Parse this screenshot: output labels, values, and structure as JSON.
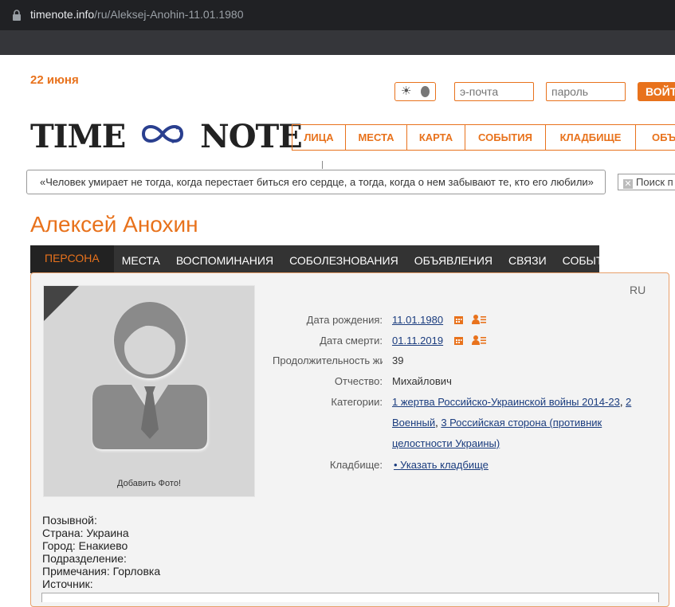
{
  "browser": {
    "url_domain": "timenote.info",
    "url_path": "/ru/Aleksej-Anohin-11.01.1980"
  },
  "header": {
    "date": "22 июня",
    "email_placeholder": "э-почта",
    "password_placeholder": "пароль",
    "login_label": "ВОЙТ",
    "logo_left": "TIME",
    "logo_right": "NOTE"
  },
  "mainnav": [
    {
      "label": "ЛИЦА"
    },
    {
      "label": "МЕСТА"
    },
    {
      "label": "КАРТА"
    },
    {
      "label": "СОБЫТИЯ"
    },
    {
      "label": "КЛАДБИЩЕ"
    },
    {
      "label": "ОБЪ"
    }
  ],
  "quote": "«Человек умирает не тогда, когда перестает биться его сердце, а тогда, когда о нем забывают те, кто его любили»",
  "search_placeholder": "Поиск п",
  "person": {
    "name": "Алексей Анохин",
    "lang": "RU",
    "photo_caption": "Добавить Фото!"
  },
  "tabs": [
    {
      "label": "ПЕРСОНА"
    },
    {
      "label": "МЕСТА"
    },
    {
      "label": "ВОСПОМИНАНИЯ"
    },
    {
      "label": "СОБОЛЕЗНОВАНИЯ"
    },
    {
      "label": "ОБЪЯВЛЕНИЯ"
    },
    {
      "label": "СВЯЗИ"
    },
    {
      "label": "СОБЫТИЯ"
    }
  ],
  "info": {
    "birth_label": "Дата рождения:",
    "birth_value": "11.01.1980",
    "death_label": "Дата смерти:",
    "death_value": "01.11.2019",
    "duration_label": "Продолжительность жи",
    "duration_value": "39",
    "patronymic_label": "Отчество:",
    "patronymic_value": "Михайлович",
    "categories_label": "Категории:",
    "cat1": "1 жертва Российско-Украинской войны 2014-23",
    "cat2": "2 Военный",
    "cat3_line1": "3 Российская сторона (противник",
    "cat3_line2": "целостности Украины)",
    "cemetery_label": "Кладбище:",
    "cemetery_value": "• Указать кладбище"
  },
  "details": {
    "callsign": "Позывной:",
    "country": "Страна: Украина",
    "city": "Город: Енакиево",
    "unit": "Подразделение:",
    "notes": "Примечания: Горловка",
    "source": "Источник:"
  },
  "colors": {
    "accent": "#e8721c",
    "link": "#1a3c7e",
    "tabbar": "#333333"
  }
}
